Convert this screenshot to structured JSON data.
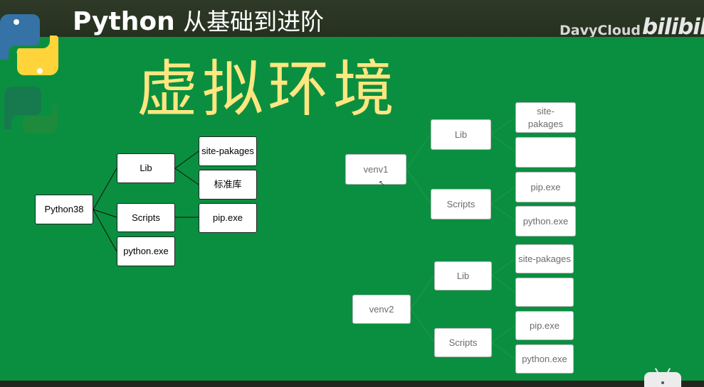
{
  "header": {
    "title_bold": "Python",
    "title_rest": "从基础到进阶",
    "channel": "DavyCloud",
    "platform_logo": "bilibili"
  },
  "slide": {
    "title": "虚拟环境"
  },
  "tree_python38": {
    "root": "Python38",
    "lib": "Lib",
    "site_packages": "site-pakages",
    "stdlib": "标准库",
    "scripts": "Scripts",
    "pip": "pip.exe",
    "python_exe": "python.exe"
  },
  "tree_venv1": {
    "root": "venv1",
    "lib": "Lib",
    "site_packages": "site-\npakages",
    "empty": "",
    "scripts": "Scripts",
    "pip": "pip.exe",
    "python_exe": "python.exe"
  },
  "tree_venv2": {
    "root": "venv2",
    "lib": "Lib",
    "site_packages": "site-pakages",
    "empty": "",
    "scripts": "Scripts",
    "pip": "pip.exe",
    "python_exe": "python.exe"
  },
  "icons": {
    "python_logo": "python-logo-icon",
    "tv": "bilibili-tv-icon",
    "cursor": "mouse-cursor-icon"
  },
  "colors": {
    "slide_background": "#0a8f40",
    "title_yellow": "#ffe680",
    "header_bar": "#2b3424",
    "python_blue": "#3572a5",
    "python_yellow": "#ffd43b"
  }
}
